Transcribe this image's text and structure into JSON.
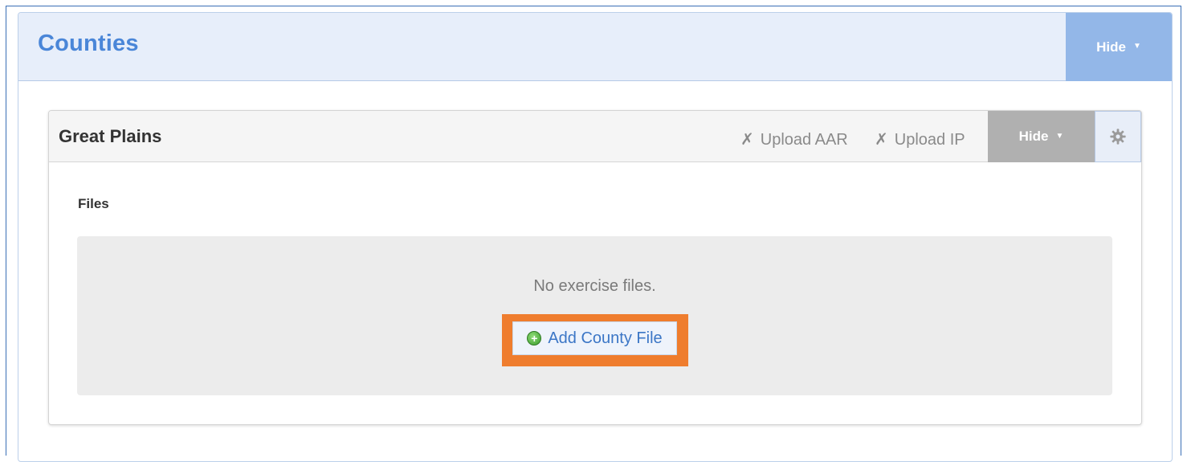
{
  "counties_panel": {
    "title": "Counties",
    "hide_label": "Hide",
    "hide_caret": "▼",
    "header_color": "#e7eefa",
    "title_color": "#4a86d8",
    "hide_button_color": "#93b7e8"
  },
  "county": {
    "name": "Great Plains",
    "upload_aar": {
      "mark": "✗",
      "label": "Upload AAR"
    },
    "upload_ip": {
      "mark": "✗",
      "label": "Upload IP"
    },
    "hide_label": "Hide",
    "hide_caret": "▼",
    "settings_icon": "gear-icon"
  },
  "files": {
    "label": "Files",
    "empty_message": "No exercise files.",
    "add_button_label": "Add County File",
    "add_button_icon": "plus-circle-icon",
    "highlight_color": "#ef7d2e"
  }
}
